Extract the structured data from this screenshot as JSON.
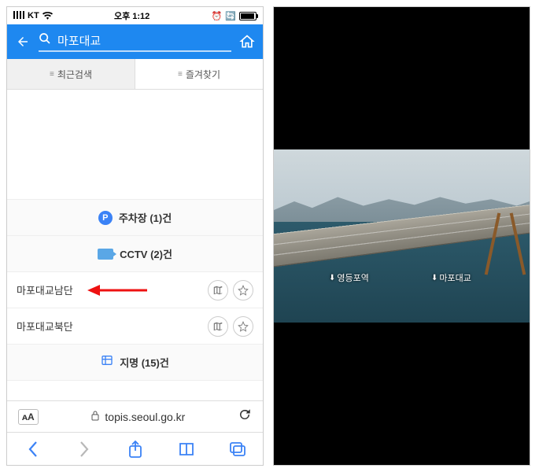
{
  "status": {
    "carrier": "KT",
    "time": "오후 1:12"
  },
  "search": {
    "value": "마포대교"
  },
  "tabs": {
    "recent": "최근검색",
    "favorites": "즐겨찾기"
  },
  "sections": {
    "parking": {
      "label": "주차장 (1)건"
    },
    "cctv": {
      "label": "CCTV (2)건"
    },
    "places": {
      "label": "지명 (15)건"
    }
  },
  "cctv_list": [
    {
      "name": "마포대교남단"
    },
    {
      "name": "마포대교북단"
    }
  ],
  "url": "topis.seoul.go.kr",
  "video": {
    "label_left": "영등포역",
    "label_right": "마포대교"
  }
}
